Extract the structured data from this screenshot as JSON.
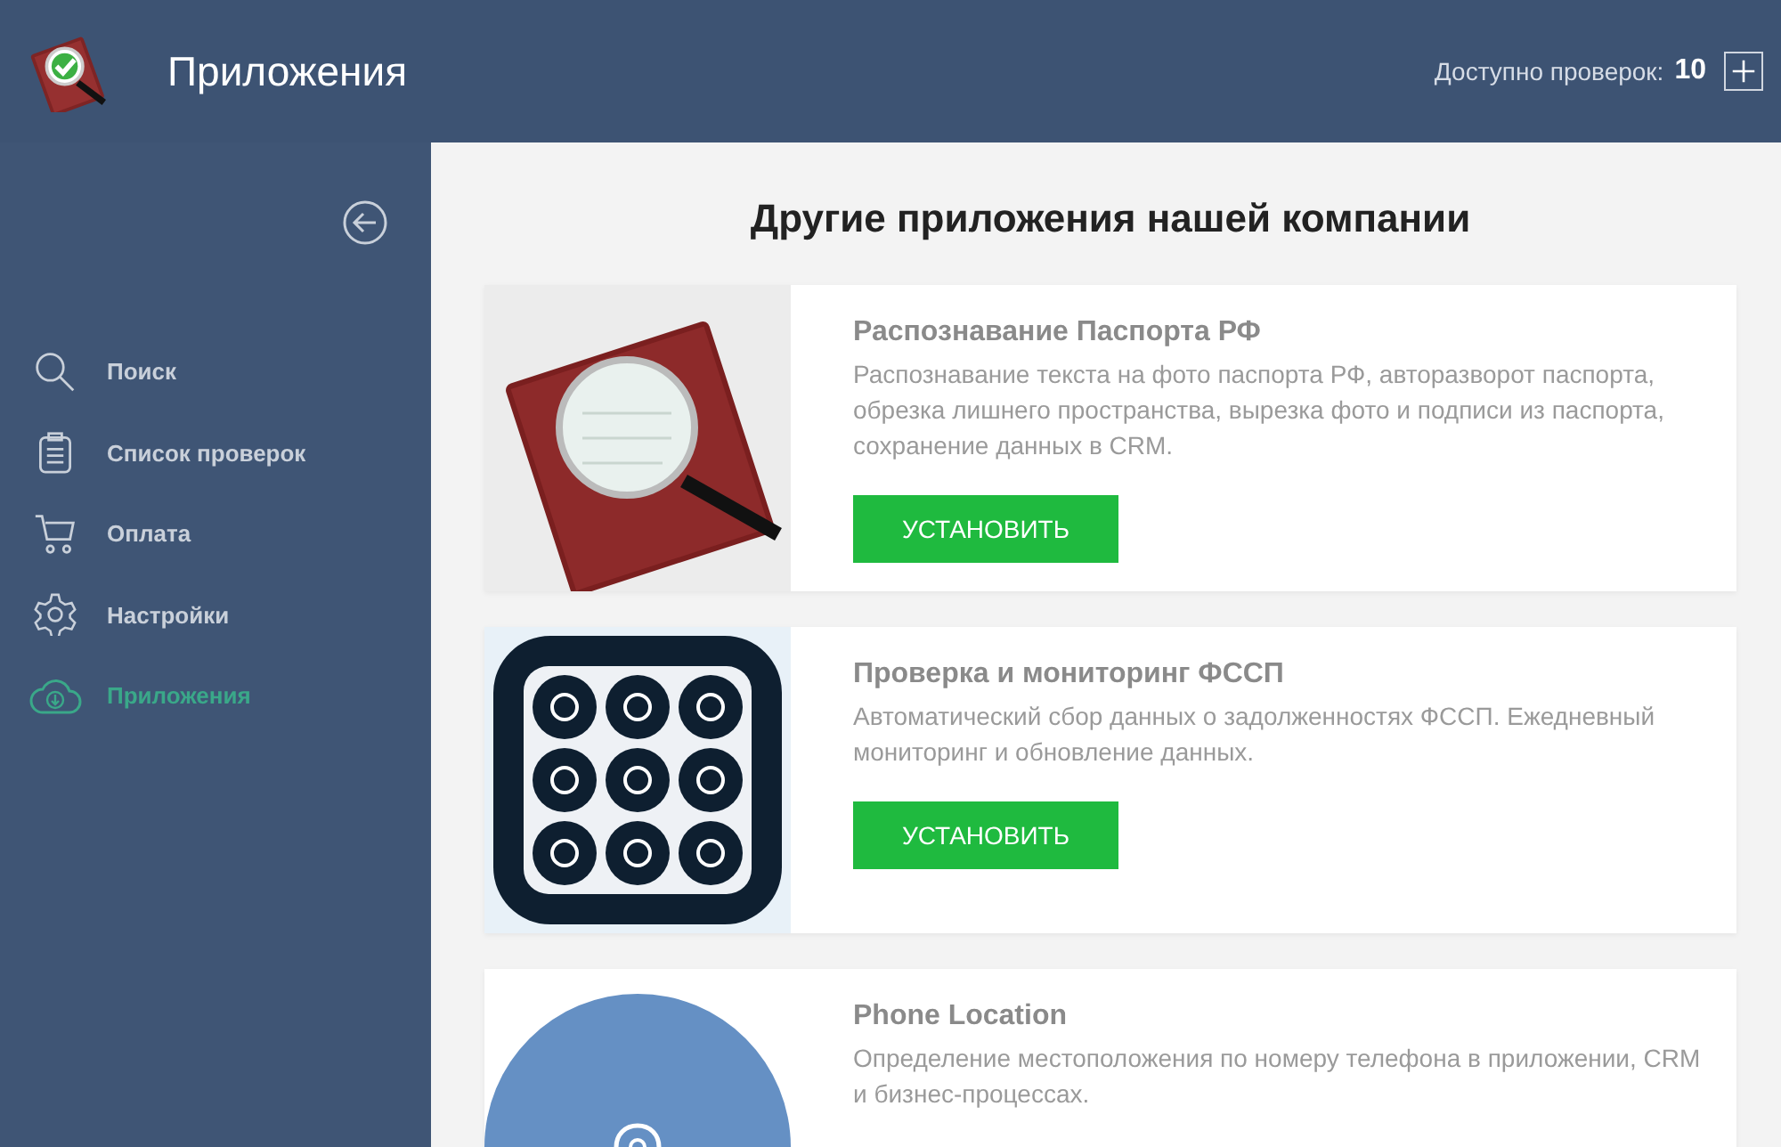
{
  "header": {
    "title": "Приложения",
    "checks_label": "Доступно проверок:",
    "checks_count": "10"
  },
  "sidebar": {
    "items": [
      {
        "label": "Поиск",
        "kind": "search",
        "selected": false
      },
      {
        "label": "Список проверок",
        "kind": "list",
        "selected": false
      },
      {
        "label": "Оплата",
        "kind": "cart",
        "selected": false
      },
      {
        "label": "Настройки",
        "kind": "settings",
        "selected": false
      },
      {
        "label": "Приложения",
        "kind": "apps",
        "selected": true
      }
    ]
  },
  "main": {
    "heading": "Другие приложения нашей компании",
    "apps": [
      {
        "kind": "passport",
        "title": "Распознавание Паспорта РФ",
        "description": "Распознавание текста на фото паспорта РФ, авторазворот паспорта, обрезка лишнего пространства, вырезка фото и подписи из паспорта, сохранение данных в CRM.",
        "button": "УСТАНОВИТЬ"
      },
      {
        "kind": "fssp",
        "title": "Проверка и мониторинг ФССП",
        "description": "Автоматический сбор данных о задолженностях ФССП. Ежедневный мониторинг и обновление данных.",
        "button": "УСТАНОВИТЬ"
      },
      {
        "kind": "location",
        "title": "Phone Location",
        "description": "Определение местоположения по номеру телефона в приложении, CRM и бизнес-процессах."
      }
    ]
  }
}
